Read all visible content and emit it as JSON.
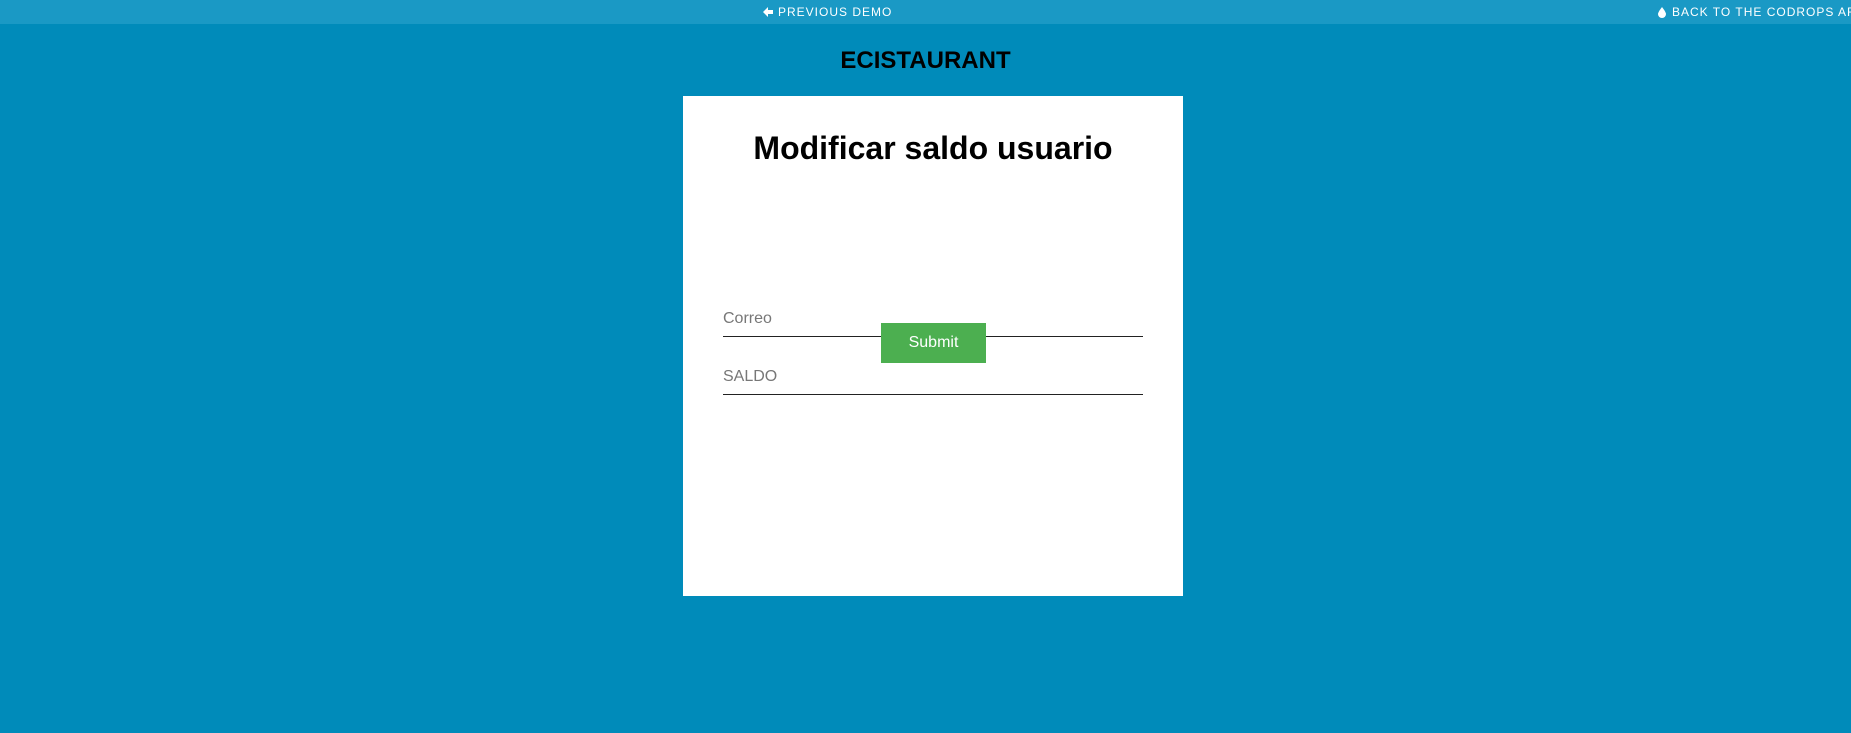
{
  "topbar": {
    "previous_label": "PREVIOUS DEMO",
    "previous_icon": "arrow-left-icon",
    "back_label": "BACK TO THE CODROPS ARTICLE",
    "back_icon": "drop-icon"
  },
  "brand": {
    "title": "ECISTAURANT"
  },
  "form": {
    "title": "Modificar saldo usuario",
    "email_placeholder": "Correo",
    "email_value": "",
    "saldo_placeholder": "SALDO",
    "saldo_value": "",
    "submit_label": "Submit"
  },
  "colors": {
    "background": "#008bba",
    "topbar": "#1a99c5",
    "card": "#ffffff",
    "submit": "#4caf50"
  }
}
